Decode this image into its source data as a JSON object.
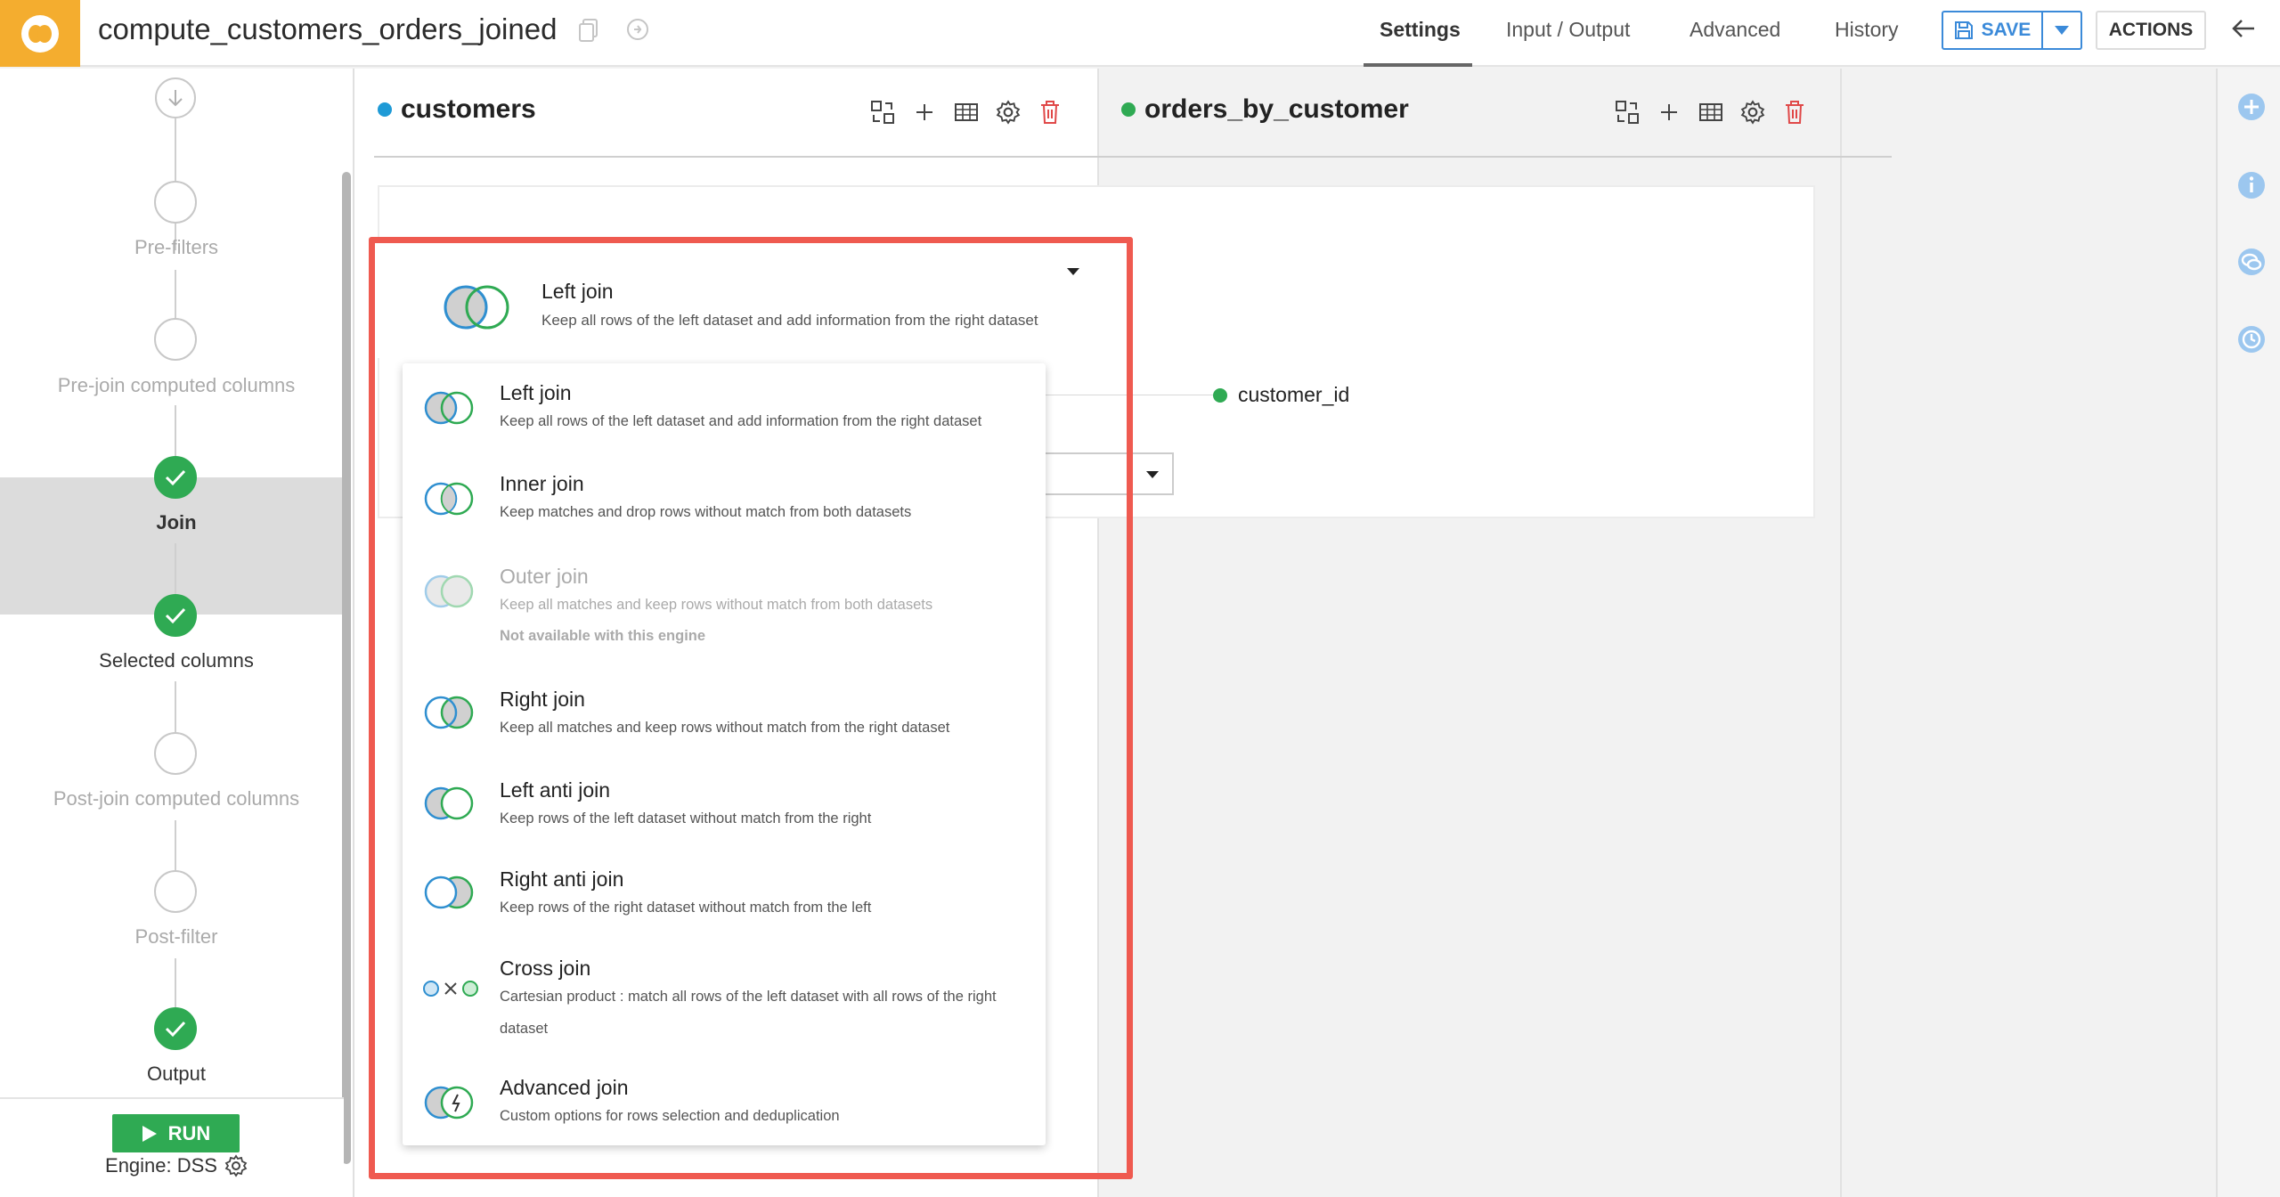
{
  "app": {
    "recipe_name": "compute_customers_orders_joined"
  },
  "nav": {
    "tabs": [
      {
        "label": "Settings",
        "active": true
      },
      {
        "label": "Input / Output",
        "active": false
      },
      {
        "label": "Advanced",
        "active": false
      },
      {
        "label": "History",
        "active": false
      }
    ],
    "save_label": "SAVE",
    "actions_label": "ACTIONS"
  },
  "steps": [
    {
      "label": "Pre-filters",
      "state": "pending"
    },
    {
      "label": "Pre-join computed columns",
      "state": "pending"
    },
    {
      "label": "Join",
      "state": "done",
      "active": true
    },
    {
      "label": "Selected columns",
      "state": "done"
    },
    {
      "label": "Post-join computed columns",
      "state": "pending"
    },
    {
      "label": "Post-filter",
      "state": "pending"
    },
    {
      "label": "Output",
      "state": "done"
    }
  ],
  "run": {
    "label": "RUN",
    "engine_label": "Engine: DSS"
  },
  "datasets": {
    "left": {
      "name": "customers",
      "color": "#1e9ad6"
    },
    "right": {
      "name": "orders_by_customer",
      "color": "#2faa53"
    }
  },
  "join": {
    "selected": {
      "title": "Left join",
      "desc": "Keep all rows of the left dataset and add information from the right dataset"
    },
    "right_key": "customer_id",
    "options": [
      {
        "title": "Left join",
        "desc": "Keep all rows of the left dataset and add information from the right dataset",
        "icon": "left-join-icon",
        "enabled": true
      },
      {
        "title": "Inner join",
        "desc": "Keep matches and drop rows without match from both datasets",
        "icon": "inner-join-icon",
        "enabled": true
      },
      {
        "title": "Outer join",
        "desc": "Keep all matches and keep rows without match from both datasets",
        "note": "Not available with this engine",
        "icon": "outer-join-icon",
        "enabled": false
      },
      {
        "title": "Right join",
        "desc": "Keep all matches and keep rows without match from the right dataset",
        "icon": "right-join-icon",
        "enabled": true
      },
      {
        "title": "Left anti join",
        "desc": "Keep rows of the left dataset without match from the right",
        "icon": "left-anti-join-icon",
        "enabled": true
      },
      {
        "title": "Right anti join",
        "desc": "Keep rows of the right dataset without match from the left",
        "icon": "right-anti-join-icon",
        "enabled": true
      },
      {
        "title": "Cross join",
        "desc": "Cartesian product : match all rows of the left dataset with all rows of the right dataset",
        "icon": "cross-join-icon",
        "enabled": true
      },
      {
        "title": "Advanced join",
        "desc": "Custom options for rows selection and deduplication",
        "icon": "advanced-join-icon",
        "enabled": true
      }
    ]
  },
  "colors": {
    "brand": "#f4ad2f",
    "accent": "#3b8ad9",
    "success": "#2faa53",
    "highlight": "#ef5a50",
    "left_dataset": "#1e9ad6",
    "right_dataset": "#2faa53"
  }
}
